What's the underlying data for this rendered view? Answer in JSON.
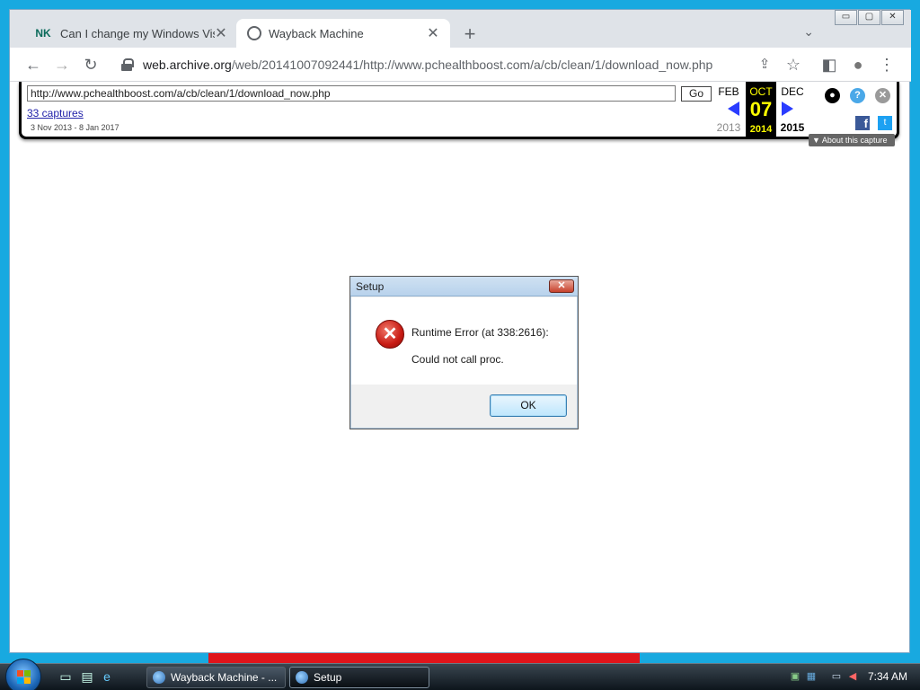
{
  "browser": {
    "window_controls": {
      "minimize": "▭",
      "restore": "▢",
      "close": "✕"
    },
    "tabs": [
      {
        "favicon_text": "NK",
        "title": "Can I change my Windows Vista",
        "close": "✕"
      },
      {
        "title": "Wayback Machine",
        "close": "✕"
      }
    ],
    "new_tab": "+",
    "tab_search": "⌄",
    "nav": {
      "back": "←",
      "forward": "→",
      "reload": "↻"
    },
    "address": {
      "host": "web.archive.org",
      "path": "/web/20141007092441/http://www.pchealthboost.com/a/cb/clean/1/download_now.php"
    },
    "actions": {
      "share": "⇪",
      "bookmark": "☆",
      "side_panel": "◧",
      "profile": "●",
      "menu": "⋮"
    }
  },
  "wayback": {
    "url_value": "http://www.pchealthboost.com/a/cb/clean/1/download_now.php",
    "go_label": "Go",
    "captures_label": "33 captures",
    "range": "3 Nov 2013 - 8 Jan 2017",
    "prev_month": "FEB",
    "prev_year": "2013",
    "current_month": "OCT",
    "current_day": "07",
    "current_year": "2014",
    "next_month": "DEC",
    "next_year": "2015",
    "about_label": "▼ About this capture",
    "help_glyph": "?",
    "close_glyph": "✕",
    "user_glyph": "●",
    "fb_glyph": "f",
    "tw_glyph": "t"
  },
  "dialog": {
    "title": "Setup",
    "close_glyph": "✕",
    "error_glyph": "✕",
    "message_line1": "Runtime Error (at 338:2616):",
    "message_line2": "Could not call proc.",
    "ok_label": "OK"
  },
  "taskbar": {
    "tasks": [
      {
        "label": "Wayback Machine - ..."
      },
      {
        "label": "Setup"
      }
    ],
    "clock": "7:34 AM"
  },
  "colors": {
    "wayback_highlight": "#ffff00",
    "wayback_arrow": "#2a3cff",
    "error_red": "#c81b14"
  }
}
